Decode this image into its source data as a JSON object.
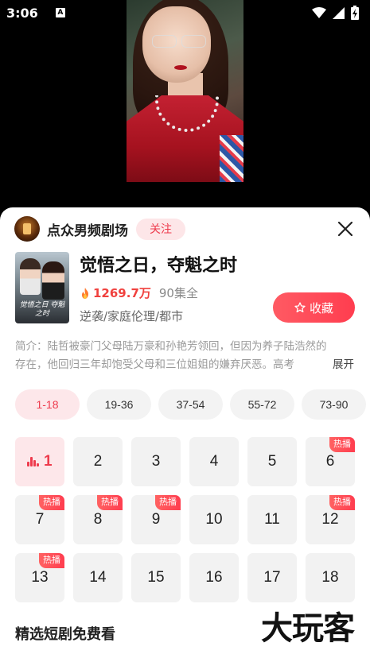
{
  "status_bar": {
    "time": "3:06",
    "notification_glyph": "A"
  },
  "channel": {
    "name": "点众男频剧场",
    "follow_label": "关注"
  },
  "drama": {
    "title": "觉悟之日，夺魁之时",
    "views": "1269.7万",
    "episodes": "90集全",
    "tags": "逆袭/家庭伦理/都市",
    "favorite_label": "收藏",
    "poster_title": "觉悟之日 夺魁之时",
    "synopsis": "简介：陆哲被豪门父母陆万豪和孙艳芳领回，但因为养子陆浩然的存在，他回归三年却饱受父母和三位姐姐的嫌弃厌恶。高考",
    "expand_label": "展开"
  },
  "ranges": [
    "1-18",
    "19-36",
    "37-54",
    "55-72",
    "73-90"
  ],
  "active_range": 0,
  "episodes": [
    {
      "num": "1",
      "active": true,
      "hot": ""
    },
    {
      "num": "2",
      "hot": ""
    },
    {
      "num": "3",
      "hot": ""
    },
    {
      "num": "4",
      "hot": ""
    },
    {
      "num": "5",
      "hot": ""
    },
    {
      "num": "6",
      "hot": "热播"
    },
    {
      "num": "7",
      "hot": "热播"
    },
    {
      "num": "8",
      "hot": "热播"
    },
    {
      "num": "9",
      "hot": "热播"
    },
    {
      "num": "10",
      "hot": ""
    },
    {
      "num": "11",
      "hot": ""
    },
    {
      "num": "12",
      "hot": "热播"
    },
    {
      "num": "13",
      "hot": "热播"
    },
    {
      "num": "14",
      "hot": ""
    },
    {
      "num": "15",
      "hot": ""
    },
    {
      "num": "16",
      "hot": ""
    },
    {
      "num": "17",
      "hot": ""
    },
    {
      "num": "18",
      "hot": ""
    }
  ],
  "featured_title": "精选短剧免费看",
  "watermark": "大玩客",
  "colors": {
    "accent": "#ee3b4d",
    "accent_light": "#fde7ea",
    "tile_bg": "#f2f2f2"
  }
}
